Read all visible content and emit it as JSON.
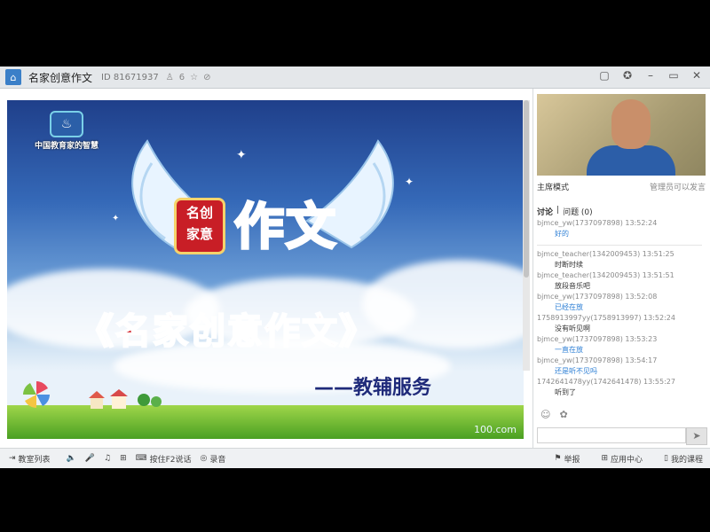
{
  "window": {
    "title": "名家创意作文",
    "room_id": "ID 81671937",
    "viewer_count": "6"
  },
  "slide": {
    "logo_text": "中国教育家的智慧",
    "badge_line1": "名创",
    "badge_line2": "家意",
    "hero_text": "作文",
    "main_title": "《名家创意作文》",
    "subtitle": "——教辅服务",
    "watermark": "100.com"
  },
  "sidebar": {
    "mode_label": "主席模式",
    "permission_note": "管理员可以发言",
    "tab_discussion": "讨论",
    "tab_questions": "问题 (0)",
    "messages": [
      {
        "meta": "bjmce_yw(1737097898) 13:52:24",
        "text": "好的",
        "blue": true
      },
      {
        "meta": "bjmce_teacher(1342009453) 13:51:25",
        "text": "时断时续",
        "blue": false
      },
      {
        "meta": "bjmce_teacher(1342009453) 13:51:51",
        "text": "放段音乐吧",
        "blue": false
      },
      {
        "meta": "bjmce_yw(1737097898) 13:52:08",
        "text": "已经在放",
        "blue": true
      },
      {
        "meta": "1758913997yy(1758913997) 13:52:24",
        "text": "没有听见啊",
        "blue": false
      },
      {
        "meta": "bjmce_yw(1737097898) 13:53:23",
        "text": "一直在放",
        "blue": true
      },
      {
        "meta": "bjmce_yw(1737097898) 13:54:17",
        "text": "还是听不见吗",
        "blue": true
      },
      {
        "meta": "1742641478yy(1742641478) 13:55:27",
        "text": "听到了",
        "blue": false
      }
    ],
    "send_icon": "send-icon"
  },
  "bottombar": {
    "courseware_list": "教室列表",
    "hold_f2": "按住F2说话",
    "record": "录音",
    "report": "举报",
    "app_center": "应用中心",
    "my_courses": "我的课程"
  }
}
